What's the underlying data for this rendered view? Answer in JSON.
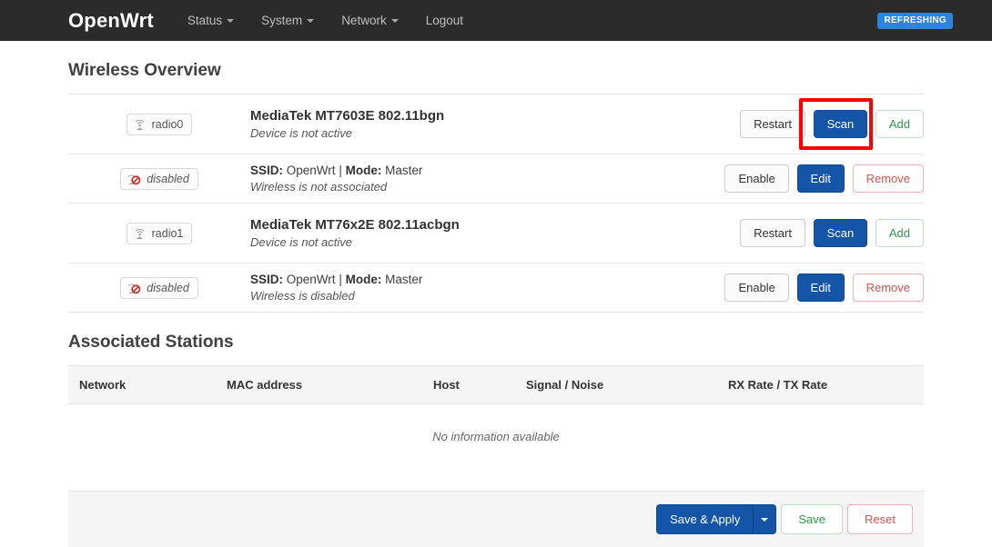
{
  "navbar": {
    "brand": "OpenWrt",
    "items": [
      {
        "label": "Status",
        "has_caret": true
      },
      {
        "label": "System",
        "has_caret": true
      },
      {
        "label": "Network",
        "has_caret": true
      },
      {
        "label": "Logout",
        "has_caret": false
      }
    ],
    "status_badge": "REFRESHING",
    "badge_color": "#2b85dd",
    "background_color": "#2b2b2b"
  },
  "wireless": {
    "title": "Wireless Overview",
    "rows": [
      {
        "type": "device",
        "badge_label": "radio0",
        "badge_icon": "wifi-icon",
        "title": "MediaTek MT7603E 802.11bgn",
        "status": "Device is not active",
        "buttons": [
          {
            "label": "Restart",
            "style": "default"
          },
          {
            "label": "Scan",
            "style": "primary",
            "highlighted": true
          },
          {
            "label": "Add",
            "style": "success"
          }
        ]
      },
      {
        "type": "network",
        "badge_label": "disabled",
        "badge_icon": "wifi-disabled-icon",
        "ssid_label": "SSID:",
        "ssid_value": "OpenWrt",
        "separator": "|",
        "mode_label": "Mode:",
        "mode_value": "Master",
        "status": "Wireless is not associated",
        "buttons": [
          {
            "label": "Enable",
            "style": "default"
          },
          {
            "label": "Edit",
            "style": "primary"
          },
          {
            "label": "Remove",
            "style": "danger"
          }
        ]
      },
      {
        "type": "device",
        "badge_label": "radio1",
        "badge_icon": "wifi-icon",
        "title": "MediaTek MT76x2E 802.11acbgn",
        "status": "Device is not active",
        "buttons": [
          {
            "label": "Restart",
            "style": "default"
          },
          {
            "label": "Scan",
            "style": "primary",
            "highlighted": false
          },
          {
            "label": "Add",
            "style": "success"
          }
        ]
      },
      {
        "type": "network",
        "badge_label": "disabled",
        "badge_icon": "wifi-disabled-icon",
        "ssid_label": "SSID:",
        "ssid_value": "OpenWrt",
        "separator": "|",
        "mode_label": "Mode:",
        "mode_value": "Master",
        "status": "Wireless is disabled",
        "buttons": [
          {
            "label": "Enable",
            "style": "default"
          },
          {
            "label": "Edit",
            "style": "primary"
          },
          {
            "label": "Remove",
            "style": "danger"
          }
        ]
      }
    ]
  },
  "stations": {
    "title": "Associated Stations",
    "columns": [
      "Network",
      "MAC address",
      "Host",
      "Signal / Noise",
      "RX Rate / TX Rate"
    ],
    "empty_message": "No information available"
  },
  "footer": {
    "save_apply_label": "Save & Apply",
    "dropdown_icon": "caret-down-icon",
    "save_label": "Save",
    "reset_label": "Reset"
  },
  "colors": {
    "primary": "#1455a8",
    "success": "#2e9c48",
    "danger": "#d9534f",
    "highlight": "#ff0000"
  }
}
